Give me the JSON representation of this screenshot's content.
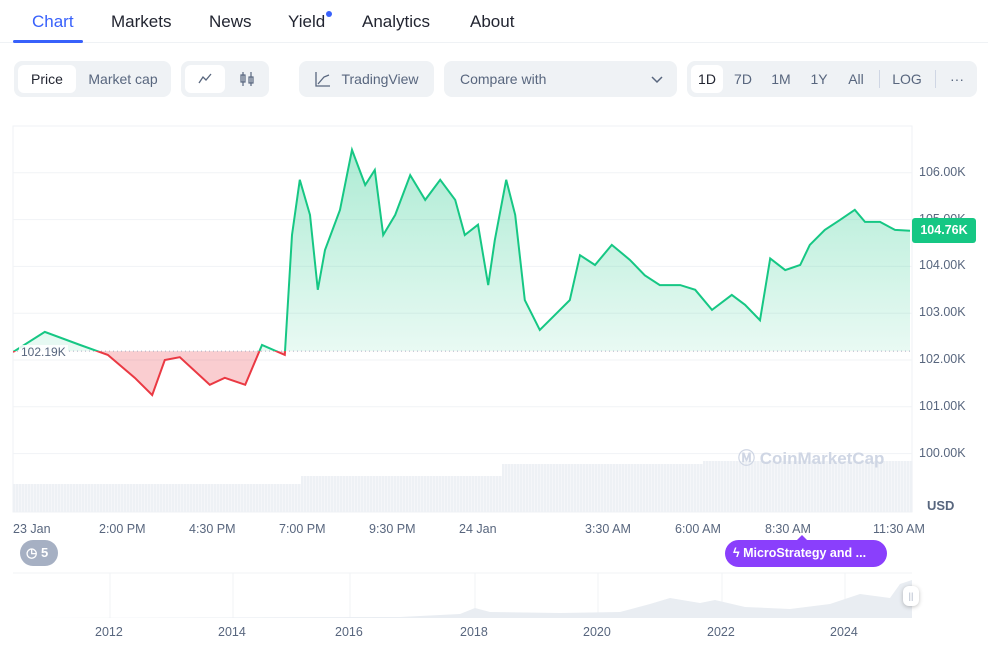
{
  "tabs": [
    {
      "label": "Chart",
      "active": true
    },
    {
      "label": "Markets"
    },
    {
      "label": "News"
    },
    {
      "label": "Yield",
      "has_dot": true
    },
    {
      "label": "Analytics"
    },
    {
      "label": "About"
    }
  ],
  "toolbar": {
    "metric": [
      "Price",
      "Market cap"
    ],
    "metric_selected": "Price",
    "chart_types": [
      "line-chart-icon",
      "candlestick-icon"
    ],
    "tradingview_label": "TradingView",
    "compare_placeholder": "Compare with",
    "ranges": [
      "1D",
      "7D",
      "1M",
      "1Y",
      "All"
    ],
    "range_selected": "1D",
    "log_label": "LOG",
    "more_label": "···"
  },
  "colors": {
    "accent": "#3861fb",
    "up": "#16c784",
    "down": "#ea3943",
    "event": "#8a3ffc"
  },
  "events": {
    "count": "5",
    "news_label": "MicroStrategy and ..."
  },
  "watermark": "CoinMarketCap",
  "navigator": {
    "years": [
      "2012",
      "2014",
      "2016",
      "2018",
      "2020",
      "2022",
      "2024"
    ]
  },
  "chart_data": {
    "type": "line",
    "currency": "USD",
    "current_price_label": "104.76K",
    "baseline_label": "102.19K",
    "baseline": 102.19,
    "ylim": [
      99.5,
      107.0
    ],
    "y_ticks": [
      "100.00K",
      "101.00K",
      "102.00K",
      "103.00K",
      "104.00K",
      "105.00K",
      "106.00K"
    ],
    "y_tick_values": [
      100,
      101,
      102,
      103,
      104,
      105,
      106
    ],
    "x_tick_labels": [
      "23 Jan",
      "2:00 PM",
      "4:30 PM",
      "7:00 PM",
      "9:30 PM",
      "24 Jan",
      "3:30 AM",
      "6:00 AM",
      "8:30 AM",
      "11:30 AM"
    ],
    "x_tick_times": [
      "23 Jan 10:55",
      "23 Jan 14:00",
      "23 Jan 16:30",
      "23 Jan 19:00",
      "23 Jan 21:30",
      "24 Jan 00:00",
      "24 Jan 03:30",
      "24 Jan 06:00",
      "24 Jan 08:30",
      "24 Jan 11:30"
    ],
    "unit": "thousand USD",
    "grid": true,
    "points": [
      [
        "23 Jan 10:55",
        102.17
      ],
      [
        "23 Jan 11:48",
        102.6
      ],
      [
        "23 Jan 12:47",
        102.32
      ],
      [
        "23 Jan 13:33",
        102.11
      ],
      [
        "23 Jan 14:18",
        101.62
      ],
      [
        "23 Jan 14:47",
        101.25
      ],
      [
        "23 Jan 15:08",
        102.0
      ],
      [
        "23 Jan 15:33",
        102.06
      ],
      [
        "23 Jan 16:23",
        101.47
      ],
      [
        "23 Jan 16:48",
        101.62
      ],
      [
        "23 Jan 17:22",
        101.47
      ],
      [
        "23 Jan 17:50",
        102.32
      ],
      [
        "23 Jan 18:28",
        102.11
      ],
      [
        "23 Jan 18:40",
        104.67
      ],
      [
        "23 Jan 18:53",
        105.85
      ],
      [
        "23 Jan 19:10",
        105.1
      ],
      [
        "23 Jan 19:23",
        103.5
      ],
      [
        "23 Jan 19:35",
        104.35
      ],
      [
        "23 Jan 20:00",
        105.21
      ],
      [
        "23 Jan 20:20",
        106.49
      ],
      [
        "23 Jan 20:42",
        105.74
      ],
      [
        "23 Jan 20:58",
        106.06
      ],
      [
        "23 Jan 21:12",
        104.67
      ],
      [
        "23 Jan 21:32",
        105.1
      ],
      [
        "23 Jan 21:57",
        105.95
      ],
      [
        "23 Jan 22:22",
        105.42
      ],
      [
        "23 Jan 22:47",
        105.85
      ],
      [
        "23 Jan 23:12",
        105.42
      ],
      [
        "23 Jan 23:28",
        104.67
      ],
      [
        "23 Jan 23:50",
        104.89
      ],
      [
        "24 Jan 00:07",
        103.6
      ],
      [
        "24 Jan 00:18",
        104.56
      ],
      [
        "24 Jan 00:37",
        105.85
      ],
      [
        "24 Jan 00:52",
        105.1
      ],
      [
        "24 Jan 01:08",
        103.28
      ],
      [
        "24 Jan 01:33",
        102.64
      ],
      [
        "24 Jan 01:58",
        102.96
      ],
      [
        "24 Jan 02:23",
        103.28
      ],
      [
        "24 Jan 02:40",
        104.24
      ],
      [
        "24 Jan 03:05",
        104.03
      ],
      [
        "24 Jan 03:33",
        104.46
      ],
      [
        "24 Jan 04:03",
        104.14
      ],
      [
        "24 Jan 04:28",
        103.81
      ],
      [
        "24 Jan 04:53",
        103.6
      ],
      [
        "24 Jan 05:27",
        103.6
      ],
      [
        "24 Jan 05:52",
        103.5
      ],
      [
        "24 Jan 06:20",
        103.07
      ],
      [
        "24 Jan 06:53",
        103.39
      ],
      [
        "24 Jan 07:15",
        103.18
      ],
      [
        "24 Jan 07:40",
        102.85
      ],
      [
        "24 Jan 07:57",
        104.17
      ],
      [
        "24 Jan 08:22",
        103.92
      ],
      [
        "24 Jan 08:47",
        104.03
      ],
      [
        "24 Jan 09:03",
        104.46
      ],
      [
        "24 Jan 09:28",
        104.78
      ],
      [
        "24 Jan 09:53",
        104.99
      ],
      [
        "24 Jan 10:18",
        105.21
      ],
      [
        "24 Jan 10:35",
        104.95
      ],
      [
        "24 Jan 11:00",
        104.95
      ],
      [
        "24 Jan 11:25",
        104.78
      ],
      [
        "24 Jan 11:50",
        104.76
      ]
    ]
  }
}
